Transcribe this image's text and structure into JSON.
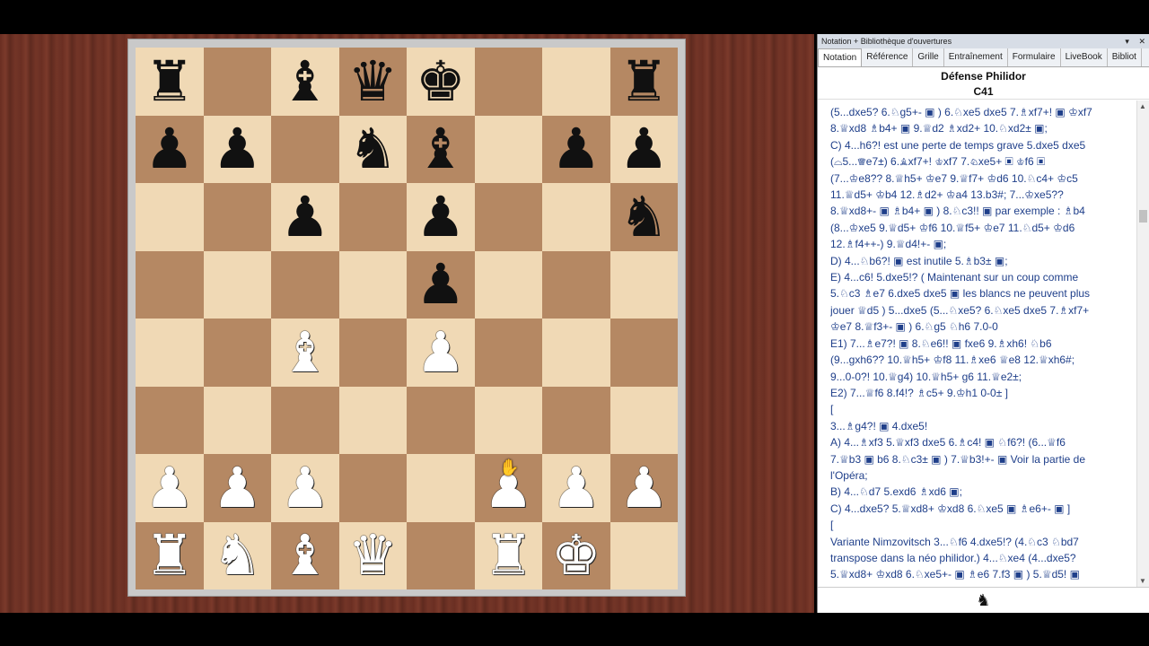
{
  "board": {
    "rows": [
      [
        "♜",
        "",
        "♝",
        "♛",
        "♚",
        "",
        "",
        "♜"
      ],
      [
        "♟",
        "♟",
        "",
        "♞",
        "♝",
        "",
        "♟",
        "♟"
      ],
      [
        "",
        "",
        "♟",
        "",
        "♟",
        "",
        "",
        "♞"
      ],
      [
        "",
        "",
        "",
        "",
        "♟",
        "",
        "",
        ""
      ],
      [
        "",
        "",
        "♗",
        "",
        "♙",
        "",
        "",
        ""
      ],
      [
        "",
        "",
        "",
        "",
        "",
        "",
        "",
        ""
      ],
      [
        "♙",
        "♙",
        "♙",
        "",
        "",
        "♙",
        "♙",
        "♙"
      ],
      [
        "♖",
        "♘",
        "♗",
        "♕",
        "",
        "♖",
        "♔",
        ""
      ]
    ]
  },
  "panel": {
    "title": "Notation + Bibliothèque d'ouvertures",
    "controls": [
      "▾",
      "✕"
    ],
    "tabs": [
      "Notation",
      "Référence",
      "Grille",
      "Entraînement",
      "Formulaire",
      "LiveBook",
      "Bibliot"
    ],
    "opening_name": "Défense Philidor",
    "eco": "C41",
    "lines": [
      {
        "text": "(5...dxe5? 6.♘g5+- ▣ ) 6.♘xe5 dxe5 7.♗xf7+! ▣ ♔xf7"
      },
      {
        "text": "8.♕xd8 ♗b4+ ▣ 9.♕d2 ♗xd2+ 10.♘xd2± ▣;"
      },
      {
        "text": "C) 4...h6?! est une perte de temps grave 5.dxe5 dxe5"
      },
      {
        "text": "(⌓5...♕e7±) 6.♗xf7+! ♔xf7 7.♘xe5+ ▣ ♔f6 ▣"
      },
      {
        "text": "(7...♔e8?? 8.♕h5+ ♔e7 9.♕f7+ ♔d6 10.♘c4+ ♔c5"
      },
      {
        "text": "11.♕d5+ ♔b4 12.♗d2+ ♔a4 13.b3#; 7...♔xe5??"
      },
      {
        "text": "8.♕xd8+- ▣ ♗b4+ ▣ ) 8.♘c3!! ▣ par exemple : ♗b4"
      },
      {
        "text": "(8...♔xe5 9.♕d5+ ♔f6 10.♕f5+ ♔e7 11.♘d5+ ♔d6"
      },
      {
        "text": "12.♗f4++-) 9.♕d4!+- ▣;"
      },
      {
        "text": "D) 4...♘b6?! ▣ est inutile 5.♗b3± ▣;"
      },
      {
        "text": "E) 4...c6! 5.dxe5!? ( Maintenant sur un coup comme"
      },
      {
        "text": "5.♘c3 ♗e7 6.dxe5 dxe5 ▣ les blancs ne peuvent plus"
      },
      {
        "text": "jouer ♕d5 ) 5...dxe5 (5...♘xe5? 6.♘xe5 dxe5 7.♗xf7+"
      },
      {
        "text": "♔e7 8.♕f3+- ▣ ) 6.♘g5 ♘h6 7.0-0"
      },
      {
        "text": "E1) 7...♗e7?! ▣ 8.♘e6!! ▣ fxe6 9.♗xh6! ♘b6"
      },
      {
        "text": "(9...gxh6?? 10.♕h5+ ♔f8 11.♗xe6 ♕e8 12.♕xh6#;"
      },
      {
        "text": "9...0-0?! 10.♕g4) 10.♕h5+ g6 11.♕e2±;"
      },
      {
        "text": "E2) 7...♕f6 8.f4!? ♗c5+ 9.♔h1 0-0± ]"
      },
      {
        "text": "["
      },
      {
        "text": "3...♗g4?! ▣ 4.dxe5!"
      },
      {
        "text": "A) 4...♗xf3 5.♕xf3 dxe5 6.♗c4! ▣ ♘f6?! (6...♕f6"
      },
      {
        "text": "7.♕b3 ▣ b6 8.♘c3± ▣ ) 7.♕b3!+- ▣ Voir la partie de"
      },
      {
        "text": "l'Opéra;"
      },
      {
        "text": "B) 4...♘d7 5.exd6 ♗xd6 ▣;"
      },
      {
        "text": "C) 4...dxe5? 5.♕xd8+ ♔xd8 6.♘xe5 ▣ ♗e6+- ▣ ]"
      },
      {
        "text": "["
      },
      {
        "text": "Variante Nimzovitsch 3...♘f6 4.dxe5!? (4.♘c3 ♘bd7"
      },
      {
        "text": "transpose dans la néo philidor.) 4...♘xe4 (4...dxe5?"
      },
      {
        "text": "5.♕xd8+ ♔xd8 6.♘xe5+- ▣ ♗e6 7.f3 ▣ ) 5.♕d5! ▣"
      }
    ],
    "footer_icon": "♞"
  },
  "colors": {
    "light_square": "#f0d9b5",
    "dark_square": "#b58863",
    "notation_text": "#1f3f8a"
  }
}
